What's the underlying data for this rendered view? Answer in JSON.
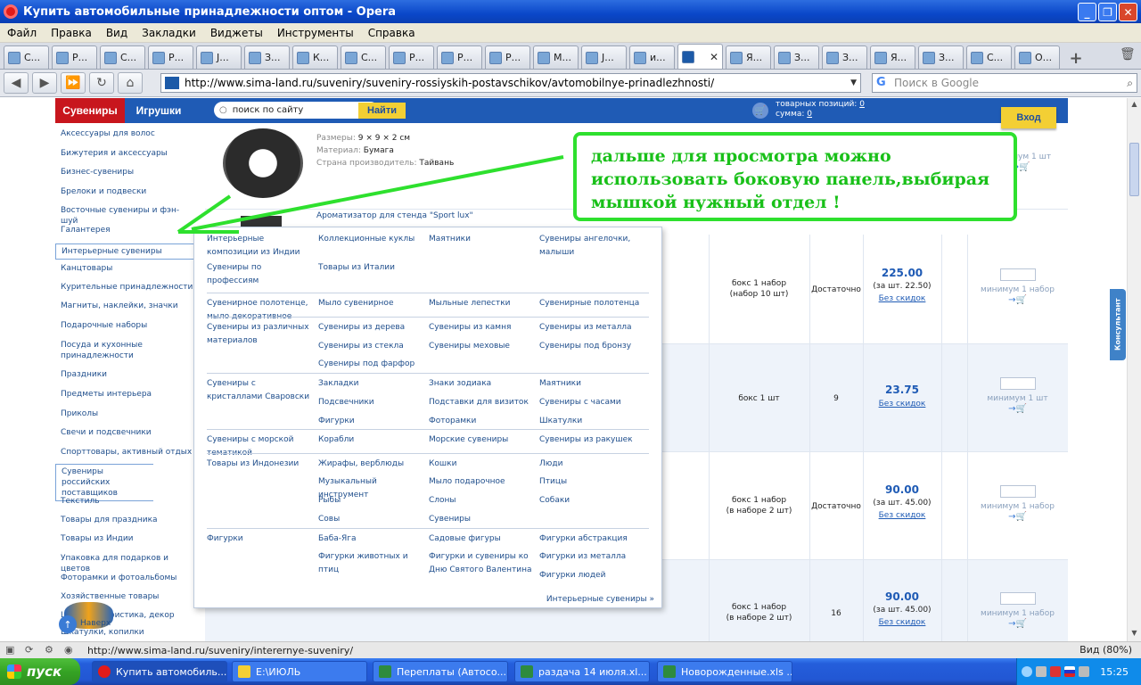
{
  "window": {
    "title": "Купить автомобильные принадлежности оптом - Opera",
    "min": "_",
    "max": "❐",
    "close": "✕"
  },
  "menu": [
    "Файл",
    "Правка",
    "Вид",
    "Закладки",
    "Виджеты",
    "Инструменты",
    "Справка"
  ],
  "tabs": [
    "С...",
    "Р...",
    "С...",
    "Р...",
    "J...",
    "З...",
    "К...",
    "С...",
    "Р...",
    "Р...",
    "Р...",
    "М...",
    "J...",
    "и...",
    "",
    "Я...",
    "З...",
    "З...",
    "Я...",
    "З...",
    "С...",
    "О..."
  ],
  "tab_close": "✕",
  "address": {
    "url": "http://www.sima-land.ru/suveniry/suveniry-rossiyskih-postavschikov/avtomobilnye-prinadlezhnosti/",
    "search_placeholder": "Поиск в Google"
  },
  "site": {
    "nav_souvenirs": "Сувениры",
    "nav_toys": "Игрушки",
    "search_placeholder": "поиск по сайту",
    "find_button": "Найти",
    "cart_positions_label": "товарных позиций:",
    "cart_positions": "0",
    "cart_sum_label": "сумма:",
    "cart_sum": "0",
    "login": "Вход"
  },
  "sidebar": [
    "Аксессуары для волос",
    "Бижутерия и аксессуары",
    "Бизнес-сувениры",
    "Брелоки и подвески",
    "Восточные сувениры и фэн-шуй",
    "Галантерея",
    "Интерьерные сувениры",
    "Канцтовары",
    "Курительные принадлежности",
    "Магниты, наклейки, значки",
    "Подарочные наборы",
    "Посуда и кухонные принадлежности",
    "Праздники",
    "Предметы интерьера",
    "Приколы",
    "Свечи и подсвечники",
    "Спорттовары, активный отдых",
    "Сувениры российских поставщиков",
    "Текстиль",
    "Товары для праздника",
    "Товары из Индии",
    "Упаковка для подарков и цветов",
    "Фоторамки и фотоальбомы",
    "Хозяйственные товары",
    "Цветы, флористика, декор",
    "Шкатулки, копилки"
  ],
  "product_top": {
    "size_label": "Размеры:",
    "size": "9 × 9 × 2 см",
    "material_label": "Материал:",
    "material": "Бумага",
    "country_label": "Страна производитель:",
    "country": "Тайвань",
    "next_title": "Ароматизатор для стенда \"Sport lux\""
  },
  "rows": [
    {
      "pack": "бокс 1 набор\n(набор 10 шт)",
      "stock": "Достаточно",
      "price": "225.00",
      "per": "(за шт. 22.50)",
      "disc": "Без скидок",
      "min": "минимум 1 набор"
    },
    {
      "pack": "бокс 1 шт",
      "stock": "9",
      "price": "23.75",
      "per": "",
      "disc": "Без скидок",
      "min": "минимум 1 шт"
    },
    {
      "pack": "бокс 1 набор\n(в наборе 2 шт)",
      "stock": "Достаточно",
      "price": "90.00",
      "per": "(за шт. 45.00)",
      "disc": "Без скидок",
      "min": "минимум 1 набор"
    },
    {
      "pack": "бокс 1 набор\n(в наборе 2 шт)",
      "stock": "16",
      "price": "90.00",
      "per": "(за шт. 45.00)",
      "disc": "Без скидок",
      "min": "минимум 1 набор"
    }
  ],
  "top_min": "минимум 1 шт",
  "megamenu": {
    "items": [
      "Интерьерные композиции из Индии",
      "Коллекционные куклы",
      "Маятники",
      "Сувениры ангелочки, малыши",
      "Сувениры по профессиям",
      "Товары из Италии",
      "Сувенирное полотенце, мыло декоративное",
      "Мыло сувенирное",
      "Мыльные лепестки",
      "Сувенирные полотенца",
      "Сувениры из различных материалов",
      "Сувениры из дерева",
      "Сувениры из камня",
      "Сувениры из металла",
      "Сувениры из стекла",
      "Сувениры меховые",
      "Сувениры под бронзу",
      "Сувениры под фарфор",
      "Сувениры с кристаллами Сваровски",
      "Закладки",
      "Знаки зодиака",
      "Маятники",
      "Подсвечники",
      "Подставки для визиток",
      "Сувениры с часами",
      "Фигурки",
      "Фоторамки",
      "Шкатулки",
      "Сувениры с морской тематикой",
      "Корабли",
      "Морские сувениры",
      "Сувениры из ракушек",
      "Товары из Индонезии",
      "Жирафы, верблюды",
      "Кошки",
      "Люди",
      "Музыкальный инструмент",
      "Мыло подарочное",
      "Птицы",
      "Рыбы",
      "Слоны",
      "Собаки",
      "Совы",
      "Сувениры",
      "Фигурки",
      "Баба-Яга",
      "Садовые фигуры",
      "Фигурки абстракция",
      "Фигурки животных и птиц",
      "Фигурки и сувениры ко Дню Святого Валентина",
      "Фигурки из металла",
      "Фигурки людей"
    ],
    "more": "Интерьерные сувениры »"
  },
  "annotation": "дальше для просмотра можно использовать боковую панель,выбирая мышкой нужный отдел !",
  "consultant": "Консультант",
  "up_label": "Наверх",
  "status": {
    "url": "http://www.sima-land.ru/suveniry/interernye-suveniry/",
    "zoom": "Вид (80%)"
  },
  "taskbar": {
    "start": "пуск",
    "tasks": [
      "Купить автомобиль...",
      "E:\\ИЮЛЬ",
      "Переплаты (Автосо...",
      "раздача 14 июля.xl...",
      "Новорожденные.xls ..."
    ],
    "clock": "15:25"
  },
  "colors": {
    "annotation_green": "#2ee02e",
    "header_blue": "#1f5bb5",
    "accent_red": "#c8161d",
    "button_yellow": "#f3cf34"
  }
}
